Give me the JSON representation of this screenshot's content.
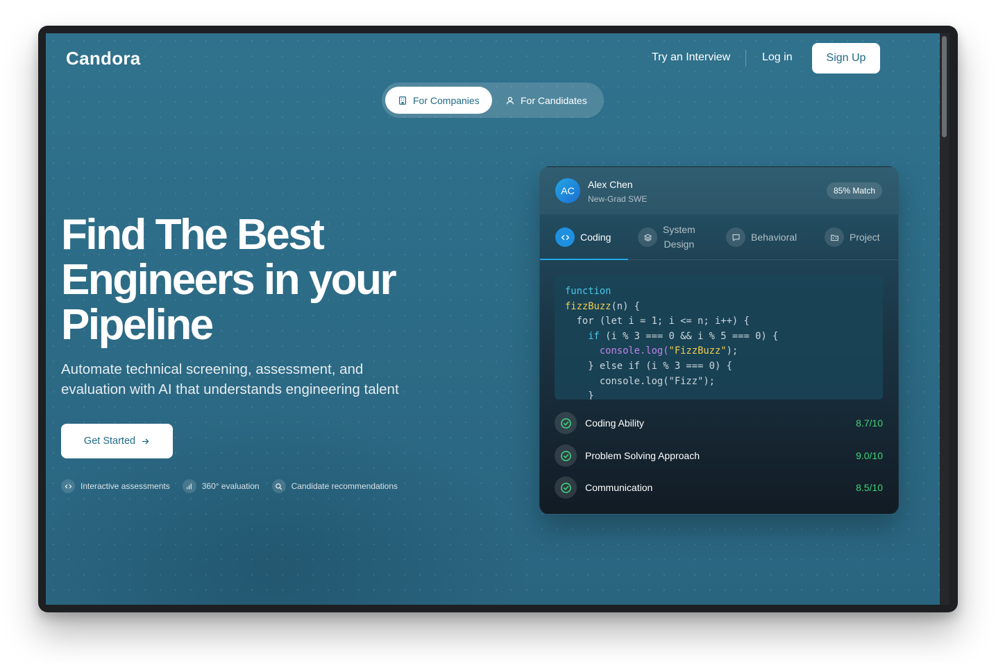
{
  "brand": {
    "name": "Candora"
  },
  "nav": {
    "try_interview": "Try an Interview",
    "login": "Log in",
    "signup": "Sign Up"
  },
  "audience_toggle": {
    "companies": "For Companies",
    "candidates": "For Candidates",
    "selected": "For Companies"
  },
  "hero": {
    "title_line1": "Find The Best",
    "title_line2": "Engineers in your",
    "title_line3": "Pipeline",
    "subtitle_line1": "Automate technical screening, assessment, and",
    "subtitle_line2": "evaluation with AI that understands engineering talent",
    "cta": "Get Started"
  },
  "features": [
    {
      "icon": "code-icon",
      "label": "Interactive assessments"
    },
    {
      "icon": "bar-chart-icon",
      "label": "360° evaluation"
    },
    {
      "icon": "search-icon",
      "label": "Candidate recommendations"
    }
  ],
  "candidate_card": {
    "initials": "AC",
    "name": "Alex Chen",
    "role": "New-Grad SWE",
    "match": "85% Match",
    "tabs": [
      {
        "label": "Coding",
        "icon": "code-icon",
        "active": true
      },
      {
        "label_line1": "System",
        "label_line2": "Design",
        "icon": "layers-icon",
        "active": false
      },
      {
        "label": "Behavioral",
        "icon": "message-icon",
        "active": false
      },
      {
        "label": "Project",
        "icon": "folder-icon",
        "active": false
      }
    ],
    "code": {
      "l1": "function",
      "l2_fn": "fizzBuzz",
      "l2_rest": "(n) {",
      "l3": "  for (let i = 1; i <= n; i++) {",
      "l4_kw": "    if",
      "l4_rest": " (i % 3 === 0 && i % 5 === 0) {",
      "l5_obj": "      console.log(",
      "l5_str": "\"FizzBuzz\"",
      "l5_end": ");",
      "l6": "    } else if (i % 3 === 0) {",
      "l7": "      console.log(\"Fizz\");",
      "l8": "    }"
    },
    "metrics": [
      {
        "label": "Coding Ability",
        "score": "8.7/10"
      },
      {
        "label": "Problem Solving Approach",
        "score": "9.0/10"
      },
      {
        "label": "Communication",
        "score": "8.5/10"
      }
    ]
  },
  "colors": {
    "background": "#2d6c87",
    "accent_blue": "#21a6e6",
    "score_green": "#3ed37a",
    "button_text": "#1f6a85"
  }
}
